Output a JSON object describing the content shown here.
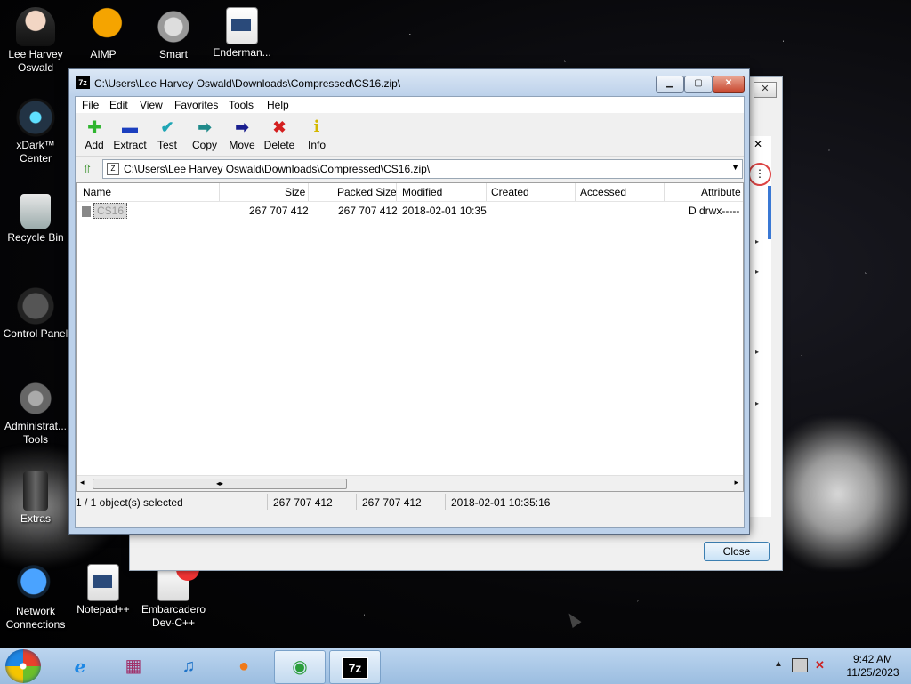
{
  "desktop": {
    "icons": [
      {
        "label": "Lee Harvey Oswald",
        "icon": "user-avatar-icon"
      },
      {
        "label": "AIMP",
        "icon": "aimp-icon"
      },
      {
        "label": "Smart",
        "icon": "smart-icon"
      },
      {
        "label": "Enderman...",
        "icon": "enderman-icon"
      },
      {
        "label": "xDark™ Center",
        "icon": "xdark-icon"
      },
      {
        "label": "Recycle Bin",
        "icon": "recycle-bin-icon"
      },
      {
        "label": "Control Panel",
        "icon": "control-panel-icon"
      },
      {
        "label": "Administrat... Tools",
        "icon": "admin-tools-icon"
      },
      {
        "label": "Extras",
        "icon": "extras-icon"
      },
      {
        "label": "Network Connections",
        "icon": "network-icon"
      },
      {
        "label": "Notepad++",
        "icon": "notepad-icon"
      },
      {
        "label": "Embarcadero Dev-C++",
        "icon": "devcpp-icon"
      }
    ]
  },
  "back_dialog": {
    "close_label": "Close",
    "close_x": "✕"
  },
  "window": {
    "title": "C:\\Users\\Lee Harvey Oswald\\Downloads\\Compressed\\CS16.zip\\",
    "title_icon": "7z",
    "menu": [
      "File",
      "Edit",
      "View",
      "Favorites",
      "Tools",
      "Help"
    ],
    "toolbar": [
      {
        "label": "Add",
        "icon": "plus-icon",
        "color": "#2fb52f",
        "glyph": "✚"
      },
      {
        "label": "Extract",
        "icon": "minus-icon",
        "color": "#1b3fbf",
        "glyph": "▬"
      },
      {
        "label": "Test",
        "icon": "check-icon",
        "color": "#1fa6b5",
        "glyph": "✔"
      },
      {
        "label": "Copy",
        "icon": "copy-arrow-icon",
        "color": "#1f8a8a",
        "glyph": "➡"
      },
      {
        "label": "Move",
        "icon": "move-arrow-icon",
        "color": "#1a1f8f",
        "glyph": "➡"
      },
      {
        "label": "Delete",
        "icon": "delete-x-icon",
        "color": "#d41f1f",
        "glyph": "✖"
      },
      {
        "label": "Info",
        "icon": "info-icon",
        "color": "#d4b800",
        "glyph": "i"
      }
    ],
    "address": "C:\\Users\\Lee Harvey Oswald\\Downloads\\Compressed\\CS16.zip\\",
    "columns": [
      "Name",
      "Size",
      "Packed Size",
      "Modified",
      "Created",
      "Accessed",
      "Attribute"
    ],
    "rows": [
      {
        "name": "CS16",
        "size": "267 707 412",
        "packed": "267 707 412",
        "modified": "2018-02-01 10:35",
        "created": "",
        "accessed": "",
        "attributes": "D drwx-----"
      }
    ],
    "status": {
      "selection": "1 / 1 object(s) selected",
      "size": "267 707 412",
      "packed": "267 707 412",
      "modified": "2018-02-01 10:35:16"
    }
  },
  "taskbar": {
    "apps": [
      {
        "name": "internet-explorer",
        "glyph": "e",
        "color": "#1e88e5"
      },
      {
        "name": "winrar",
        "glyph": "▦",
        "color": "#a0306a"
      },
      {
        "name": "itunes",
        "glyph": "♫",
        "color": "#1e73c8"
      },
      {
        "name": "firefox",
        "glyph": "●",
        "color": "#f07a1a"
      },
      {
        "name": "chrome",
        "glyph": "◉",
        "color": "#2a9d3a"
      },
      {
        "name": "7zip",
        "glyph": "7z",
        "color": "#000000"
      }
    ],
    "clock_time": "9:42 AM",
    "clock_date": "11/25/2023"
  }
}
